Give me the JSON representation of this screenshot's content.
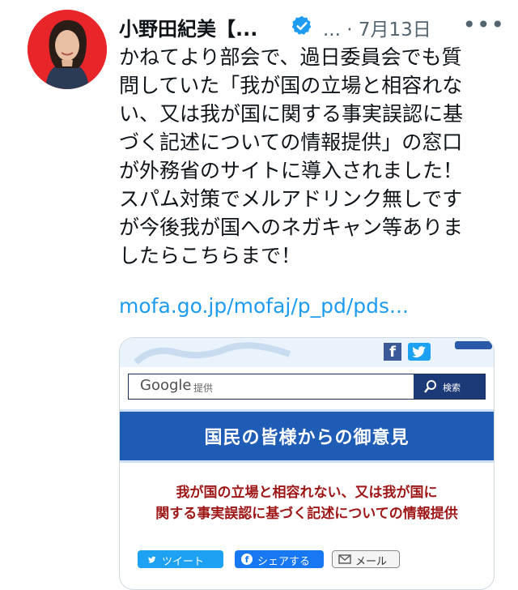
{
  "tweet": {
    "author": "小野田紀美【...",
    "meta": "... · 7月13日",
    "more_icon": "more-horizontal-icon",
    "text_lines": [
      "かねてより部会で、過日委員会でも質",
      "問していた「我が国の立場と相容れな",
      "い、又は我が国に関する事実誤認に基",
      "づく記述についての情報提供」の窓口",
      "が外務省のサイトに導入されました！",
      "スパム対策でメルアドリンク無しです",
      "が今後我が国へのネガキャン等ありま",
      "したらこちらまで！"
    ],
    "link": "mofa.go.jp/mofaj/p_pd/pds..."
  },
  "card": {
    "search": {
      "google": "Google",
      "provider": "提供",
      "button_label": "検索"
    },
    "banner_title": "国民の皆様からの御意見",
    "notice_lines": [
      "我が国の立場と相容れない、又は我が国に",
      "関する事実誤認に基づく記述についての情報提供"
    ],
    "share": {
      "tweet_label": "ツイート",
      "facebook_label": "シェアする",
      "mail_label": "メール"
    }
  },
  "colors": {
    "link": "#1d9bf0",
    "verified": "#1d9bf0",
    "banner": "#1f5cb5",
    "notice": "#9e1515",
    "avatar_bg": "#e8262a"
  }
}
